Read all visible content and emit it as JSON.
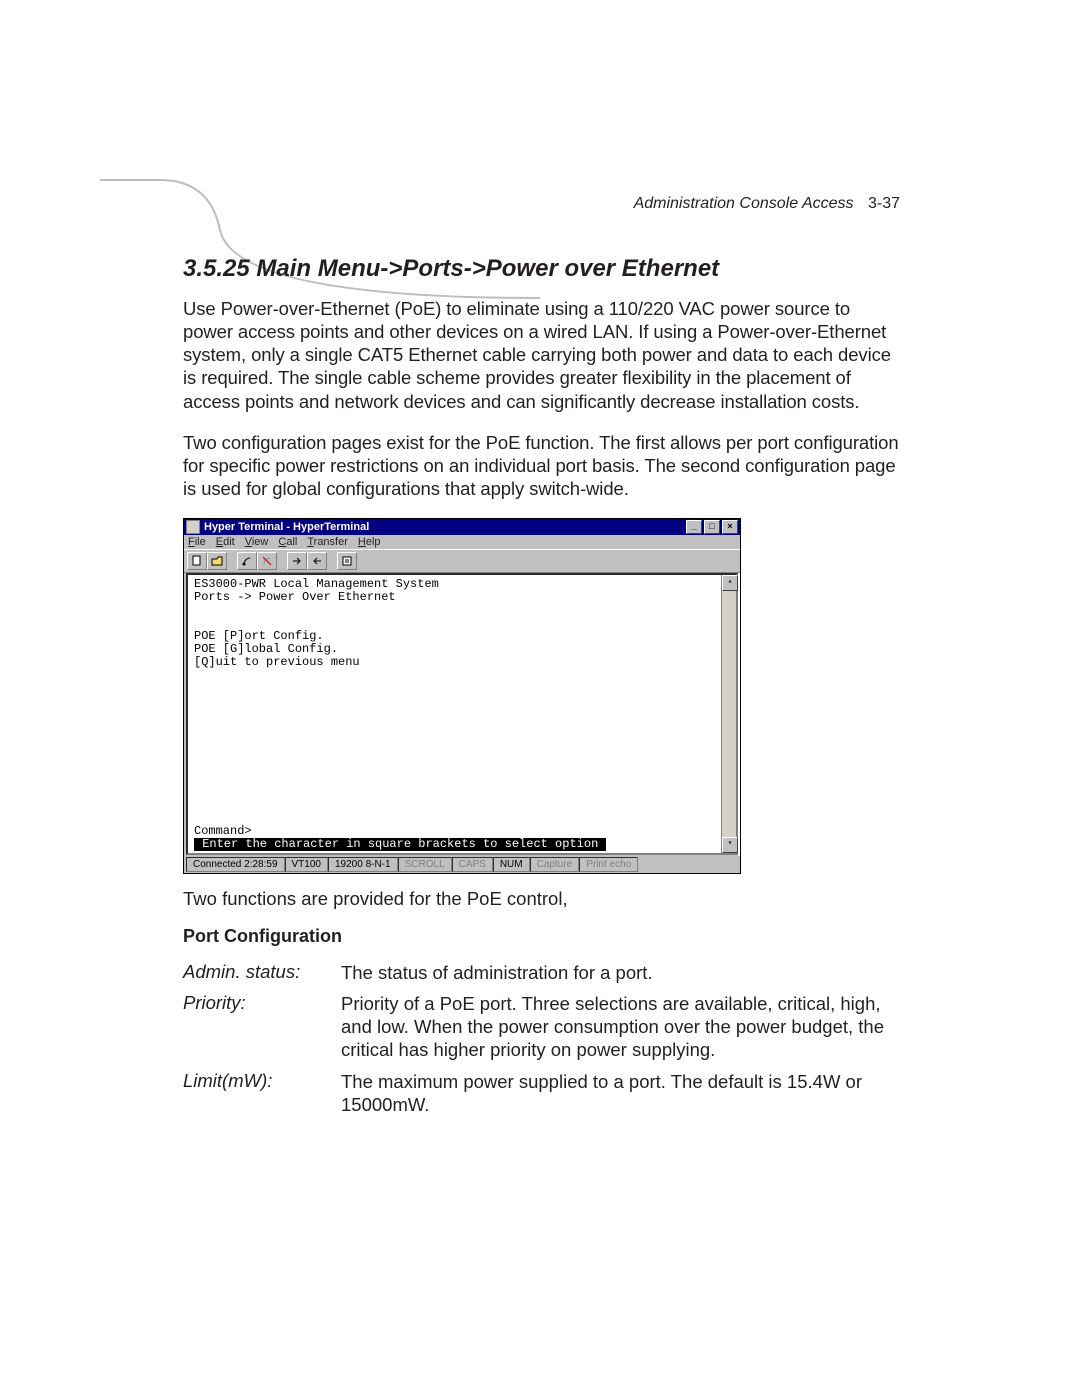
{
  "header": {
    "running_title": "Administration Console Access",
    "page_ref": "3-37"
  },
  "section": {
    "number": "3.5.25",
    "title": "Main Menu->Ports->Power over Ethernet",
    "full_heading": "3.5.25  Main Menu->Ports->Power over Ethernet"
  },
  "paragraphs": {
    "p1": "Use Power-over-Ethernet (PoE) to eliminate using a 110/220 VAC power source to power access points and other devices on a wired LAN. If using a Power-over-Ethernet system, only a single CAT5 Ethernet cable carrying both power and data to each device is required. The single cable scheme provides greater flexibility in the placement of access points and network devices and can significantly decrease installation costs.",
    "p2": "Two configuration pages exist for the PoE function. The first allows per port configuration for specific power restrictions on an individual port basis. The second configuration page is used for global configurations that apply switch-wide.",
    "below_screenshot": "Two functions are provided for the PoE control,"
  },
  "hyperterminal": {
    "title_caption": "Hyper Terminal - HyperTerminal",
    "menus": [
      "File",
      "Edit",
      "View",
      "Call",
      "Transfer",
      "Help"
    ],
    "window_buttons": {
      "min": "_",
      "max": "□",
      "close": "×"
    },
    "terminal": {
      "line1": "ES3000-PWR Local Management System",
      "line2": "Ports -> Power Over Ethernet",
      "opt1": "POE [P]ort Config.",
      "opt2": "POE [G]lobal Config.",
      "opt3": "[Q]uit to previous menu",
      "prompt": "Command>",
      "hint": " Enter the character in square brackets to select option "
    },
    "status": {
      "connected": "Connected 2:28:59",
      "emulation": "VT100",
      "line_settings": "19200 8-N-1",
      "scroll": "SCROLL",
      "caps": "CAPS",
      "num": "NUM",
      "capture": "Capture",
      "print_echo": "Print echo"
    }
  },
  "port_config": {
    "heading": "Port Configuration",
    "rows": [
      {
        "term": "Admin. status:",
        "desc": "The status of administration for a port."
      },
      {
        "term": "Priority:",
        "desc": "Priority of a PoE port. Three selections are available, critical, high, and low. When the power consumption over the power budget, the critical has higher priority on power supplying."
      },
      {
        "term": "Limit(mW):",
        "desc": "The maximum power supplied to a port. The default is 15.4W or 15000mW."
      }
    ]
  }
}
